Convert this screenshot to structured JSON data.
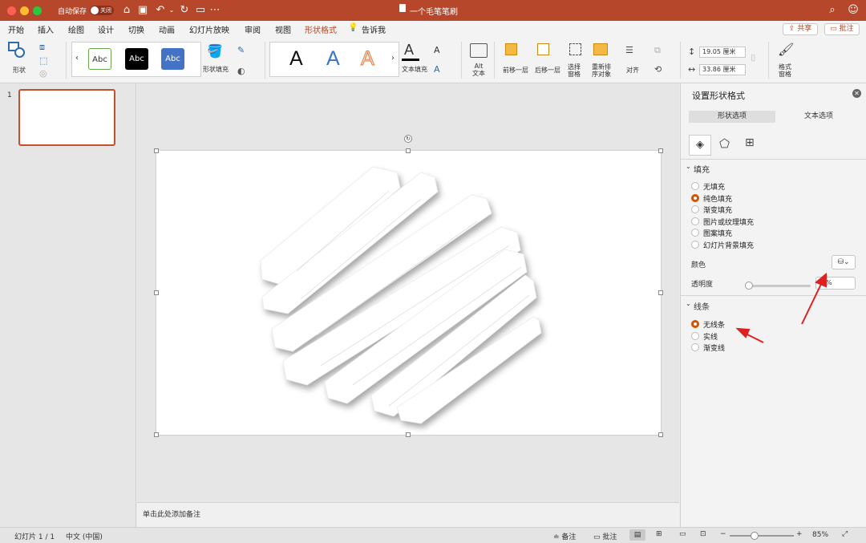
{
  "titlebar": {
    "autosave": "自动保存",
    "autosave_toggle": "关闭",
    "doc_title": "一个毛笔笔刷"
  },
  "tabs": [
    "开始",
    "插入",
    "绘图",
    "设计",
    "切换",
    "动画",
    "幻灯片放映",
    "审阅",
    "视图",
    "形状格式",
    "告诉我"
  ],
  "active_tab": "形状格式",
  "share_label": "共享",
  "comment_label": "批注",
  "ribbon": {
    "shape_label": "形状",
    "styles": [
      "Abc",
      "Abc",
      "Abc"
    ],
    "shape_fill_label": "形状填充",
    "text_fill_label": "文本填充",
    "alt_text_label": "Alt\n文本",
    "bring_forward_label": "前移一层",
    "send_backward_label": "后移一层",
    "selection_pane_label": "选择\n窗格",
    "reorder_label": "重新排\n序对象",
    "align_label": "对齐",
    "height_value": "19.05 厘米",
    "width_value": "33.86 厘米",
    "format_pane_label": "格式\n窗格"
  },
  "thumbs": {
    "number": "1"
  },
  "notes_placeholder": "单击此处添加备注",
  "panel": {
    "title": "设置形状格式",
    "tab_shape": "形状选项",
    "tab_text": "文本选项",
    "fill_header": "填充",
    "fill_options": [
      "无填充",
      "纯色填充",
      "渐变填充",
      "图片或纹理填充",
      "图案填充",
      "幻灯片背景填充"
    ],
    "fill_selected": 1,
    "color_label": "颜色",
    "transparency_label": "透明度",
    "transparency_value": "%",
    "line_header": "线条",
    "line_options": [
      "无线条",
      "实线",
      "渐变线"
    ],
    "line_selected": 0
  },
  "statusbar": {
    "slide_info": "幻灯片 1 / 1",
    "language": "中文 (中国)",
    "notes": "备注",
    "comments": "批注",
    "zoom": "85%"
  },
  "colors": {
    "accent": "#b7472a",
    "radio": "#d35400",
    "arrow": "#e02020"
  }
}
